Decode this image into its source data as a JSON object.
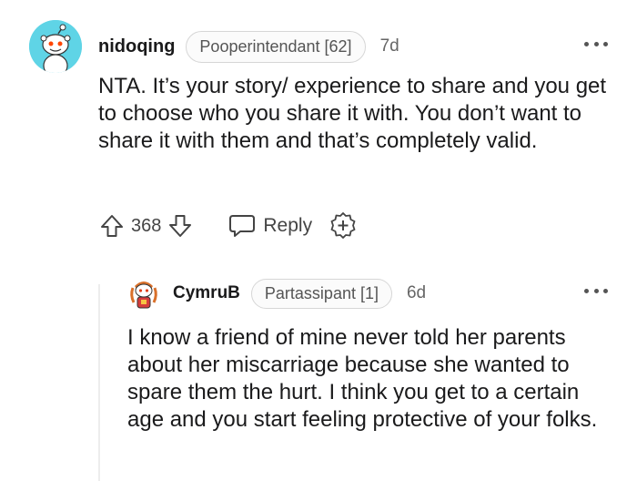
{
  "comments": [
    {
      "username": "nidoqing",
      "flair": "Pooperintendant [62]",
      "time": "7d",
      "body": "NTA. It’s your story/ experience to share and you get to choose who you share it with. You don’t want to share it with them and that’s completely valid.",
      "score": "368",
      "reply_label": "Reply",
      "avatar_icon": "snoo-avatar-icon",
      "avatar_color": "#5fd4e6"
    },
    {
      "username": "CymruB",
      "flair": "Partassipant [1]",
      "time": "6d",
      "body": "I know a friend of mine never told her parents about her miscarriage because she wanted to spare them the hurt. I think you get to a certain age and you start feeling protective of your folks.",
      "avatar_icon": "custom-snoo-avatar-icon"
    }
  ],
  "icons": {
    "upvote": "upvote-arrow-icon",
    "downvote": "downvote-arrow-icon",
    "reply": "speech-bubble-icon",
    "award": "add-award-icon",
    "more": "more-options-icon"
  }
}
